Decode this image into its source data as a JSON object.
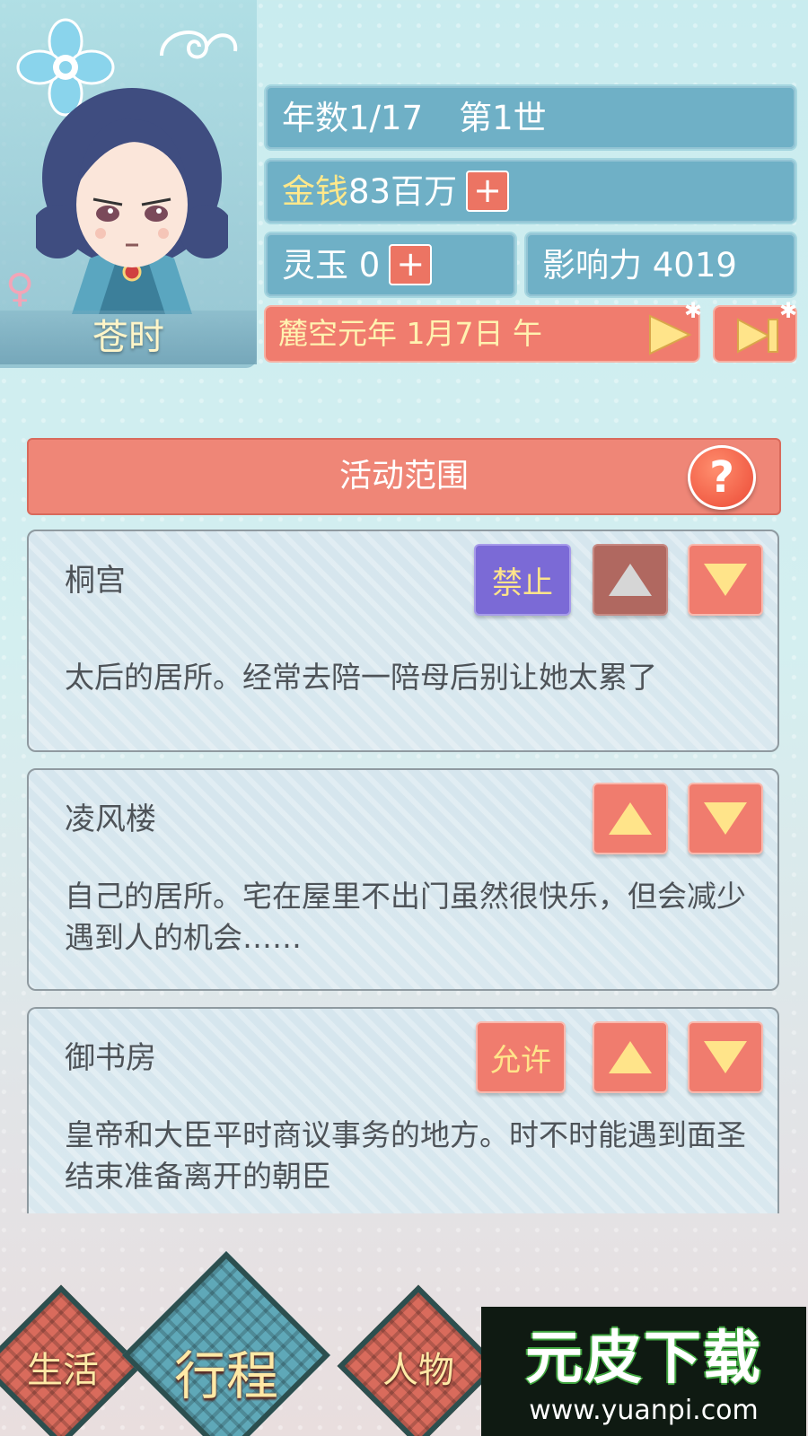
{
  "header": {
    "character_name": "苍时",
    "gender_symbol": "♀",
    "year_label": "年数1/17",
    "generation_label": "第1世",
    "money_label": "金钱",
    "money_value": "83百万",
    "plus_symbol": "+",
    "jade_label": "灵玉 0",
    "influence_label": "影响力 4019",
    "date_text": "麓空元年 1月7日 午"
  },
  "section": {
    "title": "活动范围",
    "help_symbol": "?"
  },
  "locations": [
    {
      "name": "桐宫",
      "toggle_label": "禁止",
      "description": "太后的居所。经常去陪一陪母后别让她太累了"
    },
    {
      "name": "凌风楼",
      "description": "自己的居所。宅在屋里不出门虽然很快乐，但会减少遇到人的机会……"
    },
    {
      "name": "御书房",
      "toggle_label": "允许",
      "description": "皇帝和大臣平时商议事务的地方。时不时能遇到面圣结束准备离开的朝臣"
    }
  ],
  "bottom_nav": {
    "items": [
      "生活",
      "行程",
      "人物"
    ]
  },
  "watermark": {
    "title": "元皮下载",
    "url": "www.yuanpi.com"
  },
  "colors": {
    "stat_bg": "#6fb0c6",
    "coral": "#f07c6e",
    "forbid_purple": "#7b6ad6",
    "arrow_yellow": "#ffe48a"
  }
}
